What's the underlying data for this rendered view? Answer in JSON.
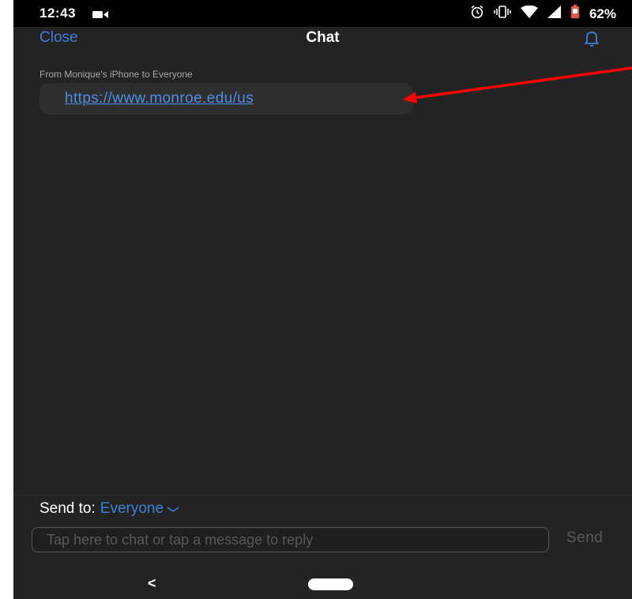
{
  "status_bar": {
    "time": "12:43",
    "battery": "62%",
    "icons": [
      "video-camera-icon",
      "alarm-icon",
      "vibrate-icon",
      "wifi-icon",
      "signal-icon",
      "battery-icon"
    ]
  },
  "header": {
    "close_label": "Close",
    "title": "Chat",
    "bell_icon": "bell-icon"
  },
  "messages": [
    {
      "from": "From Monique's iPhone to Everyone",
      "text": "https://www.monroe.edu/us"
    }
  ],
  "footer": {
    "send_to_label": "Send to:",
    "send_to_value": "Everyone",
    "input_placeholder": "Tap here to chat or tap a message to reply",
    "send_label": "Send"
  },
  "nav": {
    "back_label": "<"
  },
  "colors": {
    "background": "#232323",
    "accent": "#3d7fd6",
    "link": "#4d8fe8",
    "annotation_arrow": "#ff0000"
  }
}
